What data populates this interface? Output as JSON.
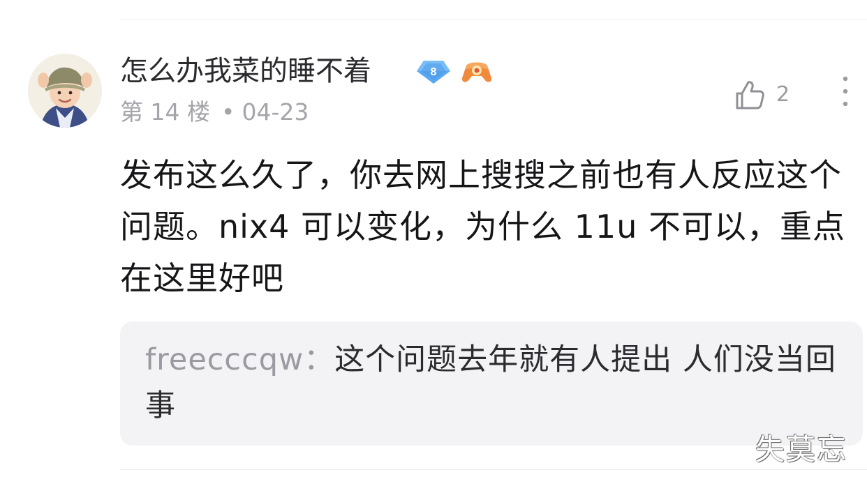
{
  "comment": {
    "username": "怎么办我菜的睡不着",
    "level_badge": "8",
    "floor": "第 14 楼",
    "separator": "•",
    "date": "04-23",
    "likes": "2",
    "content": "发布这么久了，你去网上搜搜之前也有人反应这个问题。nix4 可以变化，为什么 11u 不可以，重点在这里好吧",
    "reply": {
      "author": "freecccqw",
      "colon": "：",
      "text": "这个问题去年就有人提出 人们没当回事"
    }
  },
  "icons": {
    "avatar": "user-avatar",
    "level_badge": "diamond-level-badge-icon",
    "game_badge": "gamepad-badge-icon",
    "like": "thumbs-up-icon",
    "more": "more-vertical-icon"
  },
  "colors": {
    "badge_blue": "#5aa8f2",
    "badge_orange": "#f08a3c",
    "meta_gray": "#a4a4aa",
    "reply_bg": "#f3f3f5"
  },
  "watermark": "失莫忘"
}
